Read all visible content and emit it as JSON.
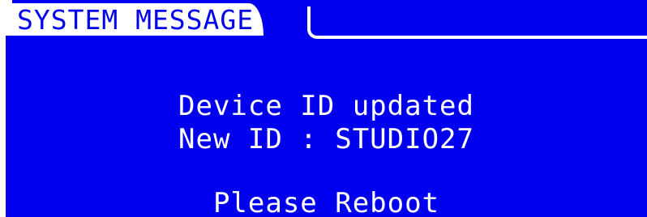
{
  "dialog": {
    "title": "SYSTEM MESSAGE",
    "lines": [
      "Device ID updated",
      "New ID : STUDIO27",
      "Please Reboot"
    ]
  },
  "colors": {
    "background": "#0000ee",
    "foreground": "#ffffff"
  }
}
